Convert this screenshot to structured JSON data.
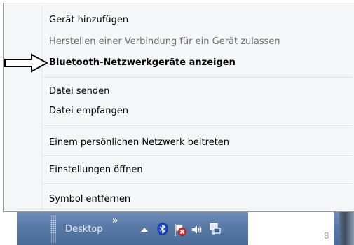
{
  "menu": {
    "items": [
      {
        "label": "Gerät hinzufügen",
        "state": "enabled"
      },
      {
        "label": "Herstellen einer Verbindung für ein Gerät zulassen",
        "state": "disabled"
      },
      {
        "label": "Bluetooth-Netzwerkgeräte anzeigen",
        "state": "bold"
      },
      {
        "label": "Datei senden",
        "state": "enabled"
      },
      {
        "label": "Datei empfangen",
        "state": "enabled"
      },
      {
        "label": "Einem persönlichen Netzwerk beitreten",
        "state": "enabled"
      },
      {
        "label": "Einstellungen öffnen",
        "state": "enabled"
      },
      {
        "label": "Symbol entfernen",
        "state": "enabled"
      }
    ]
  },
  "taskbar": {
    "toolbar_label": "Desktop",
    "overflow_chevron": "»",
    "tray_icons": [
      "show-hidden-icons-arrow",
      "bluetooth-icon",
      "action-center-flag-icon",
      "volume-icon",
      "network-icon"
    ],
    "clock_fragment": "8"
  },
  "annotation": {
    "arrow": "right-pointing-outline-arrow"
  },
  "colors": {
    "menu_bg": "#f5f6f7",
    "taskbar": "#5878a6",
    "bluetooth": "#1b4bd6"
  }
}
